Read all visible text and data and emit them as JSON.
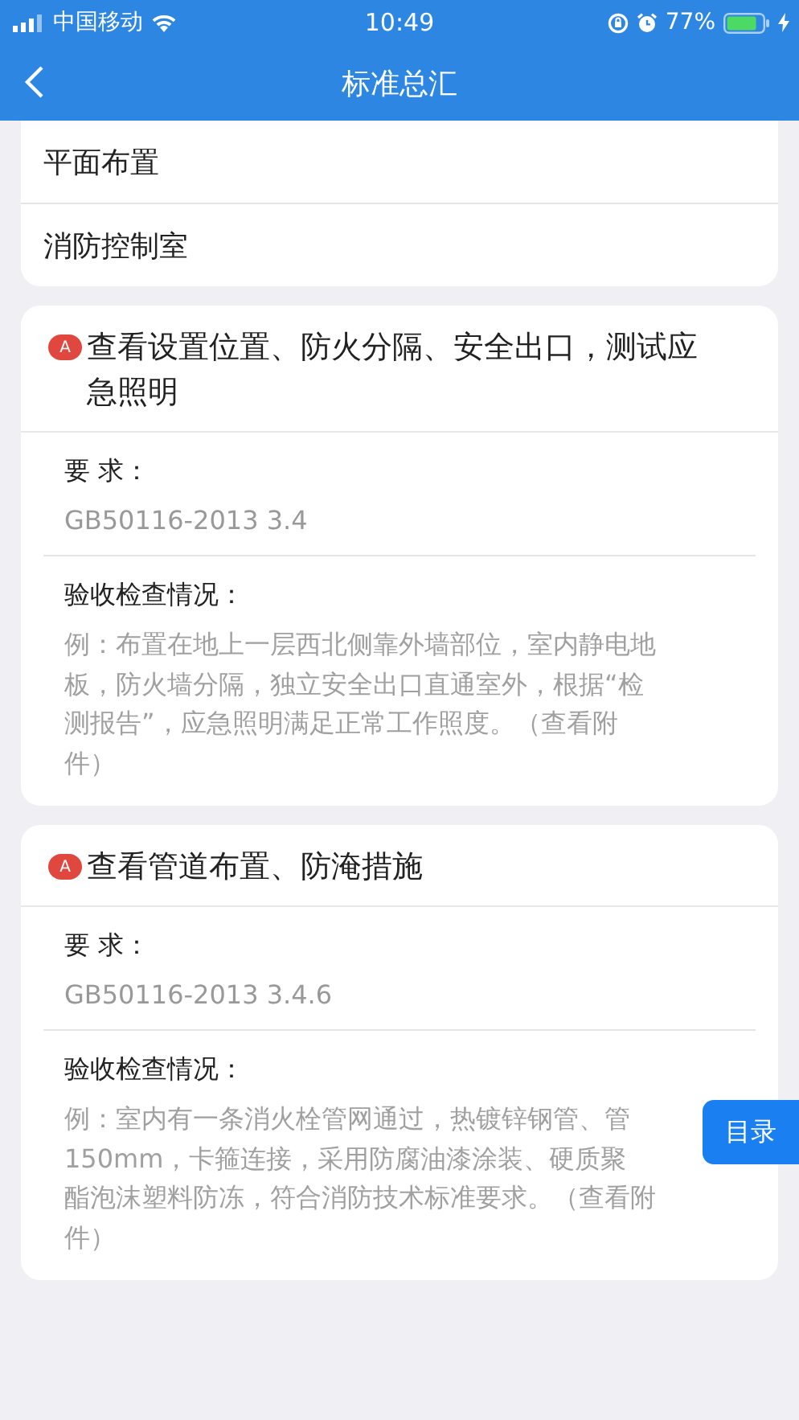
{
  "status_bar": {
    "carrier": "中国移动",
    "time": "10:49",
    "battery": "77%"
  },
  "nav": {
    "title": "标准总汇"
  },
  "menu_items": [
    {
      "label": "平面布置"
    },
    {
      "label": "消防控制室"
    }
  ],
  "items": [
    {
      "badge": "A",
      "title": "查看设置位置、防火分隔、安全出口，测试应急照明",
      "requirement_label": "要 求：",
      "requirement": "GB50116-2013 3.4",
      "check_label": "验收检查情况：",
      "check_lines": [
        "例：布置在地上一层西北侧靠外墙部位，室内静电地",
        "板，防火墙分隔，独立安全出口直通室外，根据“检",
        "测报告”，应急照明满足正常工作照度。（查看附",
        "件）"
      ]
    },
    {
      "badge": "A",
      "title": "查看管道布置、防淹措施",
      "requirement_label": "要 求：",
      "requirement": "GB50116-2013 3.4.6",
      "check_label": "验收检查情况：",
      "check_lines": [
        "例：室内有一条消火栓管网通过，热镀锌钢管、管",
        "150mm，卡箍连接，采用防腐油漆涂装、硬质聚",
        "酯泡沫塑料防冻，符合消防技术标准要求。（查看附",
        "件）"
      ]
    }
  ],
  "float_button": "目录"
}
